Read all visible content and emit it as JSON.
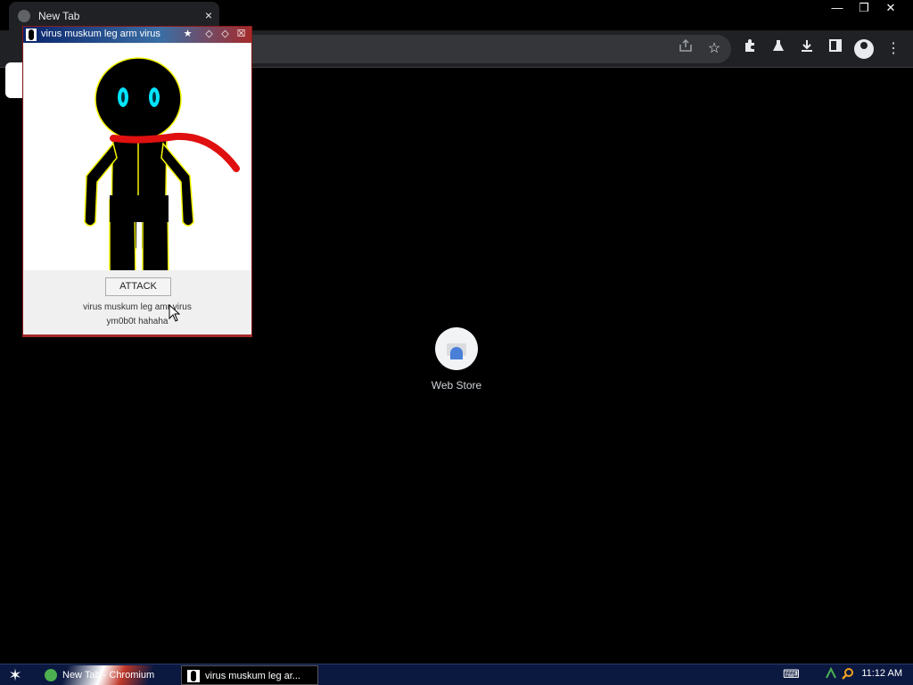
{
  "browser": {
    "tab_title": "New Tab",
    "tab_close": "×",
    "window_controls": [
      "—",
      "❐",
      "✕"
    ],
    "toolbar_icons": [
      "share-icon",
      "star-icon",
      "extensions-icon",
      "labs-icon",
      "download-icon",
      "sidepanel-icon",
      "profile-icon",
      "menu-icon"
    ]
  },
  "shortcut": {
    "label": "Web Store"
  },
  "popup": {
    "title": "virus muskum leg arm virus",
    "attack_label": "ATTACK",
    "line1": "virus muskum leg amr virus",
    "line2": "ym0b0t hahaha",
    "colors": {
      "body": "#000000",
      "eyes": "#00e5ff",
      "scarf": "#e01010",
      "outline": "#f5f500"
    }
  },
  "taskbar": {
    "task1": "New Tab - Chromium",
    "task2": "virus muskum leg ar...",
    "clock": "11:12 AM"
  }
}
